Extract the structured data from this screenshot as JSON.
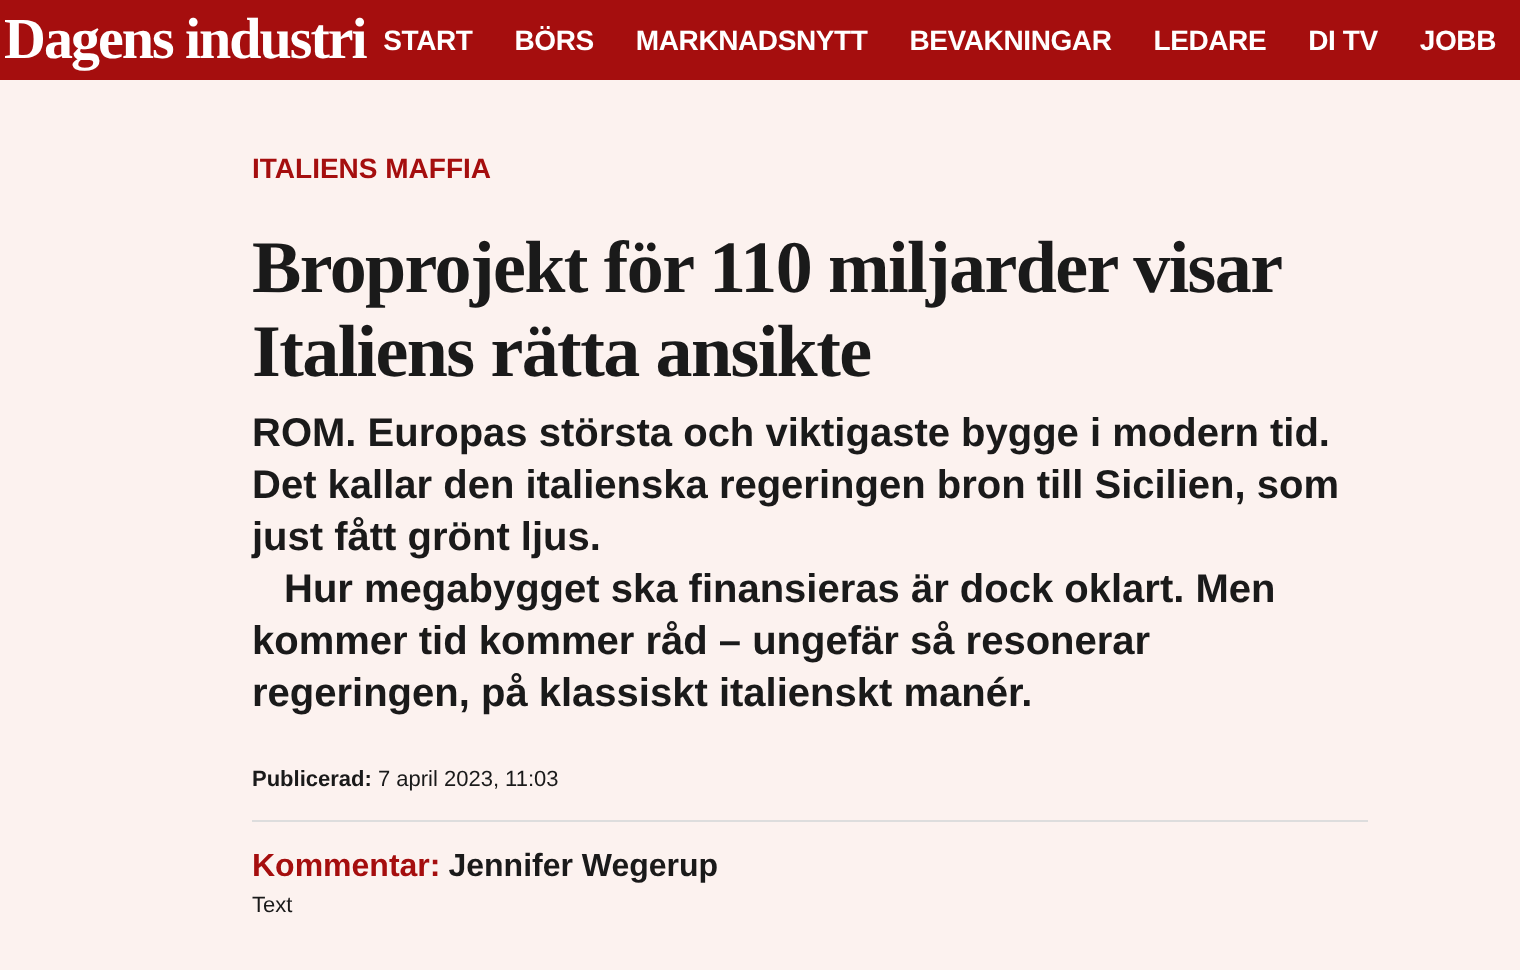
{
  "header": {
    "logo": "Dagens industri",
    "nav": [
      {
        "label": "START"
      },
      {
        "label": "BÖRS"
      },
      {
        "label": "MARKNADSNYTT"
      },
      {
        "label": "BEVAKNINGAR"
      },
      {
        "label": "LEDARE"
      },
      {
        "label": "DI TV"
      },
      {
        "label": "JOBB"
      }
    ]
  },
  "article": {
    "kicker": "ITALIENS MAFFIA",
    "headline": "Broprojekt för 110 miljarder visar Italiens rätta ansikte",
    "lede": [
      "ROM. Europas största och viktigaste bygge i modern tid. Det kallar den italienska regeringen bron till Sicilien, som just fått grönt ljus.",
      "Hur megabygget ska finansieras är dock oklart. Men kommer tid kommer råd – ungefär så resonerar regeringen, på klassiskt italienskt manér."
    ],
    "published": "**Publicerad:** 7 april 2023, 11:03",
    "byline": {
      "label": "Kommentar:",
      "author": "Jennifer Wegerup",
      "role": "Text"
    }
  }
}
